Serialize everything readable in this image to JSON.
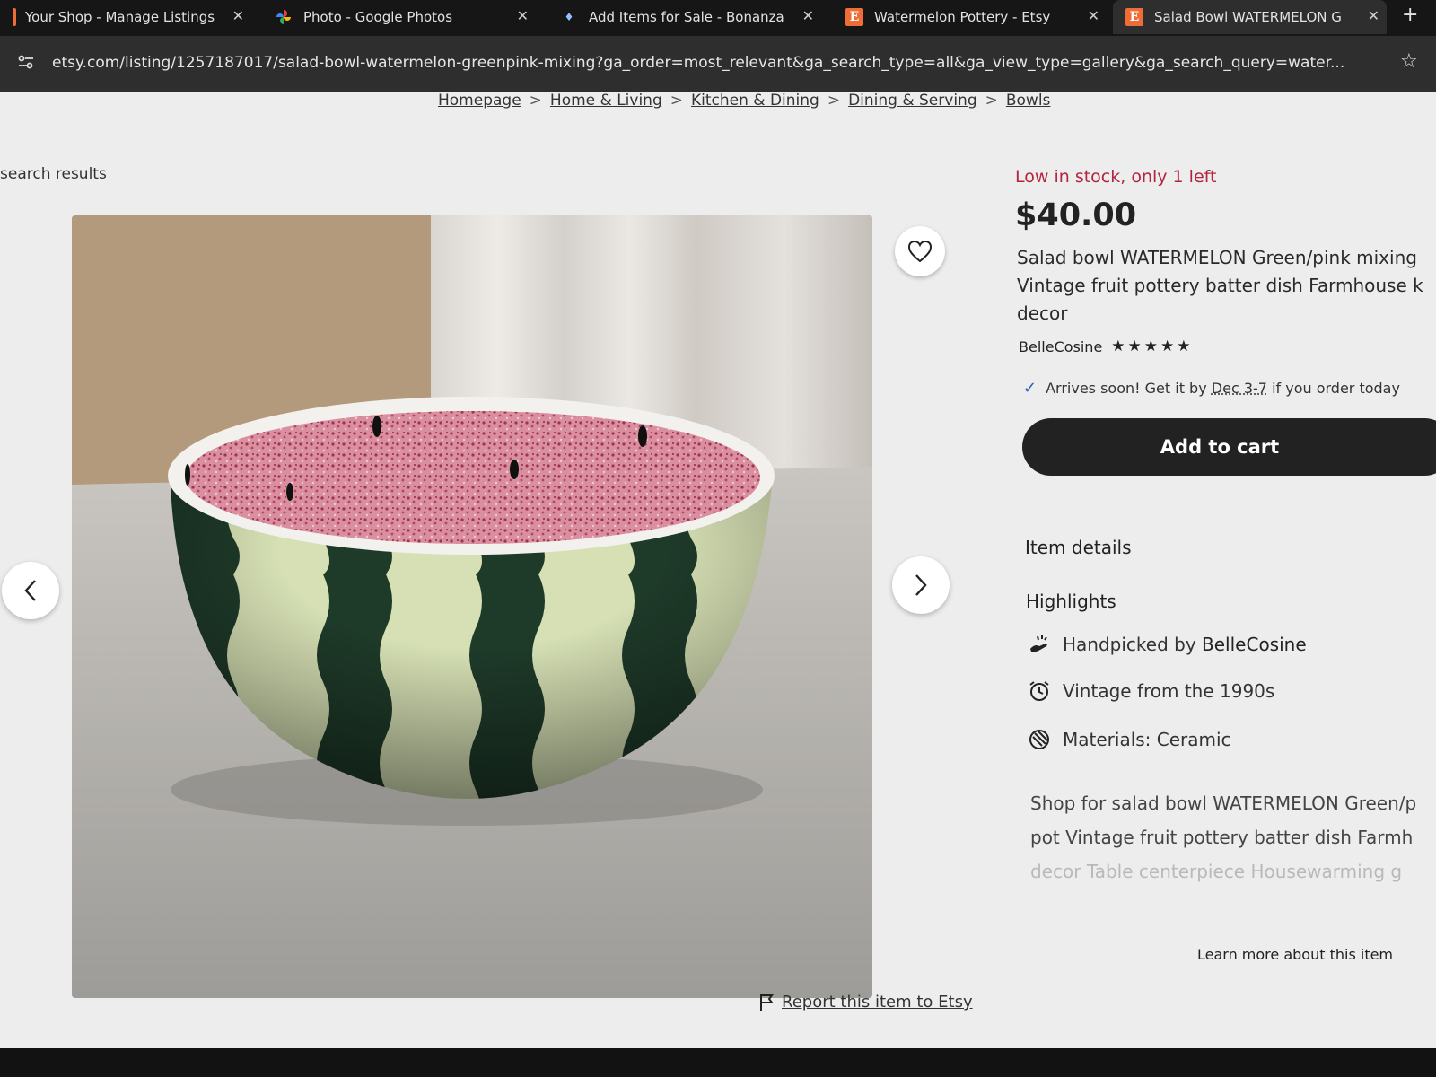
{
  "browser": {
    "tabs": [
      {
        "title": "Your Shop - Manage Listings",
        "icon": "etsy-shop-icon",
        "close": "✕"
      },
      {
        "title": "Photo - Google Photos",
        "icon": "google-photos-icon",
        "close": "✕"
      },
      {
        "title": "Add Items for Sale - Bonanza",
        "icon": "bonanza-icon",
        "close": "✕"
      },
      {
        "title": "Watermelon Pottery - Etsy",
        "icon": "etsy-icon",
        "close": "✕"
      },
      {
        "title": "Salad Bowl WATERMELON G",
        "icon": "etsy-icon",
        "close": "✕"
      }
    ],
    "new_tab": "+",
    "url": "etsy.com/listing/1257187017/salad-bowl-watermelon-greenpink-mixing?ga_order=most_relevant&ga_search_type=all&ga_view_type=gallery&ga_search_query=water..."
  },
  "breadcrumb": [
    "Homepage",
    "Home & Living",
    "Kitchen & Dining",
    "Dining & Serving",
    "Bowls"
  ],
  "breadcrumb_sep": ">",
  "back_link": "search results",
  "listing": {
    "stock": "Low in stock, only 1 left",
    "price": "$40.00",
    "title": "Salad bowl WATERMELON Green/pink mixing Vintage fruit pottery batter dish Farmhouse k decor",
    "seller": "BelleCosine",
    "rating_stars": "★★★★★",
    "rating": 5,
    "arrives_prefix": "Arrives soon! Get it by",
    "arrives_dates": "Dec 3-7",
    "arrives_suffix": "if you order today",
    "add_to_cart": "Add to cart"
  },
  "details": {
    "heading": "Item details",
    "highlights_heading": "Highlights",
    "handpicked_prefix": "Handpicked by",
    "handpicked_by": "BelleCosine",
    "vintage": "Vintage from the 1990s",
    "materials": "Materials: Ceramic",
    "description_lines": [
      "Shop for salad bowl WATERMELON Green/p",
      "pot Vintage fruit pottery batter dish Farmh",
      "decor Table centerpiece Housewarming g"
    ],
    "learn_more": "Learn more about this item"
  },
  "report": "Report this item to Etsy",
  "colors": {
    "stock_red": "#b4243c",
    "button_dark": "#222222",
    "page_bg": "#ecedec",
    "etsy_orange": "#ef6c36"
  }
}
